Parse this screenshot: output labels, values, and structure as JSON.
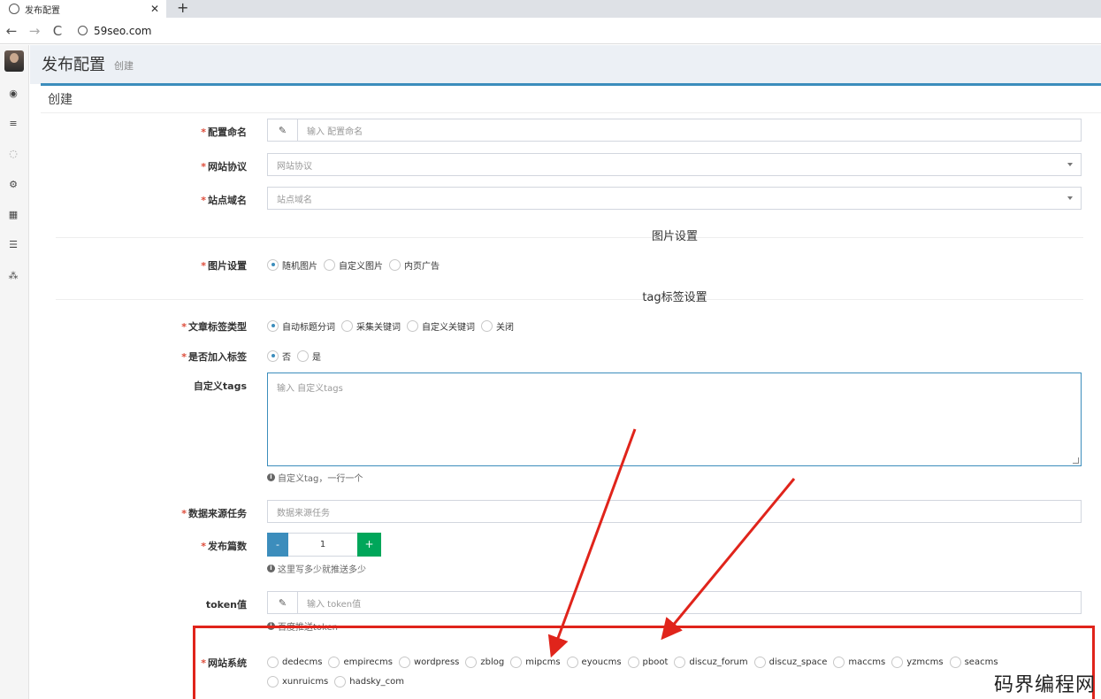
{
  "browser": {
    "tab_title": "发布配置",
    "tab_close": "✕",
    "new_tab": "+",
    "back": "←",
    "forward": "→",
    "reload": "C",
    "url": "59seo.com"
  },
  "page": {
    "title": "发布配置",
    "subtitle": "创建",
    "box_title": "创建"
  },
  "sidebar": {
    "icons": [
      "dashboard-icon",
      "list-icon",
      "globe-icon",
      "gears-icon",
      "calendar-icon",
      "menu-icon",
      "sitemap-icon"
    ]
  },
  "form": {
    "config_name": {
      "label": "配置命名",
      "placeholder": "输入 配置命名",
      "icon": "✎"
    },
    "protocol": {
      "label": "网站协议",
      "placeholder": "网站协议"
    },
    "domain": {
      "label": "站点域名",
      "placeholder": "站点域名"
    },
    "image_section": "图片设置",
    "image_setting": {
      "label": "图片设置",
      "options": [
        "随机图片",
        "自定义图片",
        "内页广告"
      ],
      "selected": 0
    },
    "tag_section": "tag标签设置",
    "tag_type": {
      "label": "文章标签类型",
      "options": [
        "自动标题分词",
        "采集关键词",
        "自定义关键词",
        "关闭"
      ],
      "selected": 0
    },
    "add_tag": {
      "label": "是否加入标签",
      "options": [
        "否",
        "是"
      ],
      "selected": 0
    },
    "custom_tags": {
      "label": "自定义tags",
      "placeholder": "输入 自定义tags",
      "help": "自定义tag，一行一个"
    },
    "source_task": {
      "label": "数据来源任务",
      "placeholder": "数据来源任务"
    },
    "publish_count": {
      "label": "发布篇数",
      "value": "1",
      "minus": "-",
      "plus": "+",
      "help": "这里写多少就推送多少"
    },
    "token": {
      "label": "token值",
      "placeholder": "输入 token值",
      "icon": "✎",
      "help": "百度推送token"
    },
    "cms": {
      "label": "网站系统",
      "options": [
        "dedecms",
        "empirecms",
        "wordpress",
        "zblog",
        "mipcms",
        "eyoucms",
        "pboot",
        "discuz_forum",
        "discuz_space",
        "maccms",
        "yzmcms",
        "seacms",
        "xunruicms",
        "hadsky_com"
      ]
    }
  },
  "watermark": "码界编程网",
  "colors": {
    "primary": "#3c8dbc",
    "success": "#00a65a",
    "required": "#dd4b39",
    "annotation": "#e0241b"
  }
}
